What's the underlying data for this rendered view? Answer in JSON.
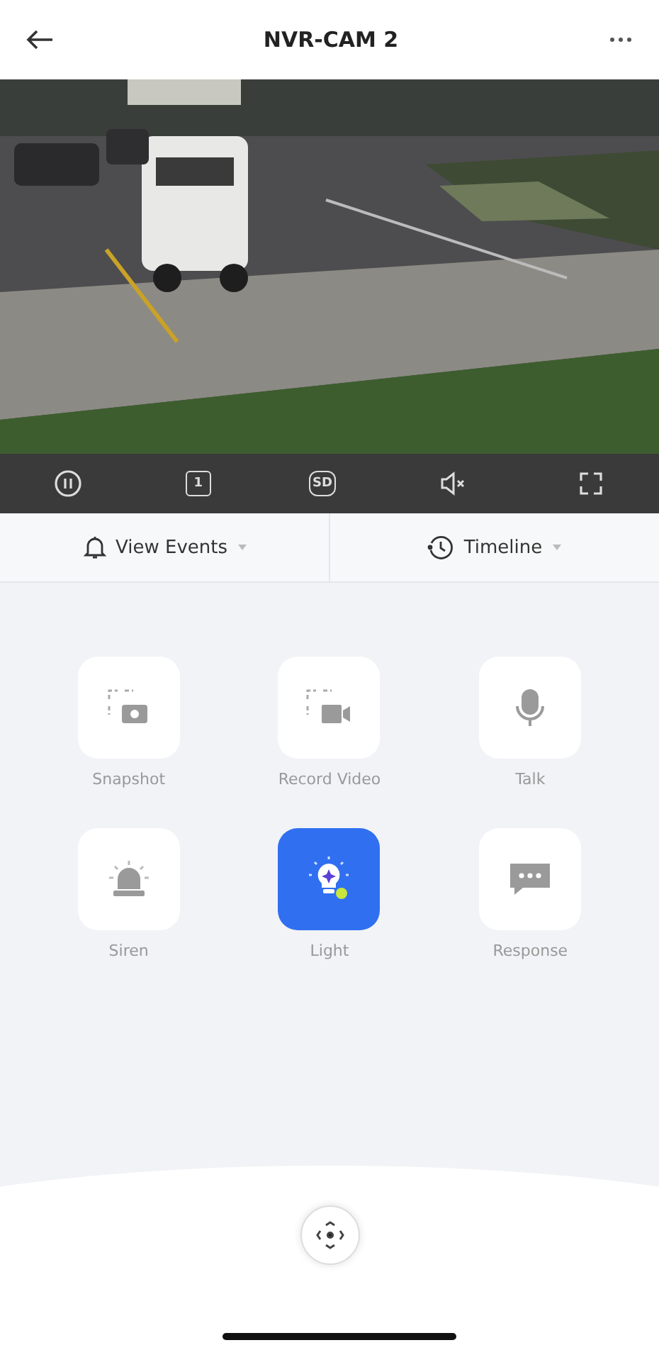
{
  "header": {
    "title": "NVR-CAM 2"
  },
  "player_controls": [
    {
      "kind": "pause"
    },
    {
      "kind": "channel",
      "label": "1"
    },
    {
      "kind": "quality",
      "label": "SD"
    },
    {
      "kind": "mute"
    },
    {
      "kind": "fullscreen"
    }
  ],
  "tabs": [
    {
      "kind": "events",
      "label": "View Events"
    },
    {
      "kind": "timeline",
      "label": "Timeline"
    }
  ],
  "actions": [
    {
      "kind": "snapshot",
      "label": "Snapshot",
      "selected": false
    },
    {
      "kind": "record",
      "label": "Record Video",
      "selected": false
    },
    {
      "kind": "talk",
      "label": "Talk",
      "selected": false
    },
    {
      "kind": "siren",
      "label": "Siren",
      "selected": false
    },
    {
      "kind": "light",
      "label": "Light",
      "selected": true
    },
    {
      "kind": "response",
      "label": "Response",
      "selected": false
    }
  ]
}
